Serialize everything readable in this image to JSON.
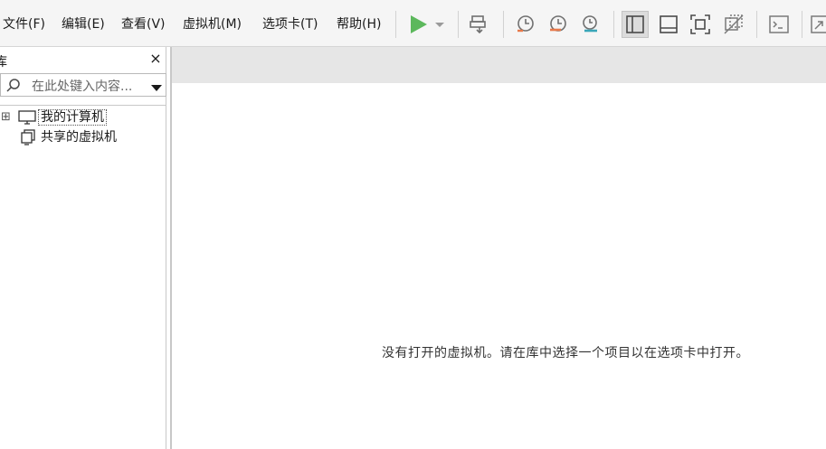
{
  "menu": {
    "items": [
      {
        "label": "文件(F)"
      },
      {
        "label": "编辑(E)"
      },
      {
        "label": "查看(V)"
      },
      {
        "label": "虚拟机(M)"
      },
      {
        "label": "选项卡(T)"
      },
      {
        "label": "帮助(H)"
      }
    ]
  },
  "toolbar": {
    "icons": [
      "play-icon",
      "play-dropdown-icon",
      "send-ctrl-alt-del-icon",
      "snapshot-take-icon",
      "snapshot-revert-icon",
      "snapshot-manager-icon",
      "show-library-icon",
      "thumbnail-bar-icon",
      "full-screen-icon",
      "unity-mode-icon",
      "console-view-icon",
      "stretch-guest-icon"
    ],
    "colors": {
      "play": "#5cb85c",
      "snapshot_accent": "#e8794a",
      "snapshot_teal": "#3aa6b9"
    }
  },
  "library": {
    "title": "库",
    "close_glyph": "×",
    "search": {
      "placeholder": "在此处键入内容..."
    },
    "tree": [
      {
        "label": "我的计算机",
        "expander": "⊞"
      },
      {
        "label": "共享的虚拟机"
      }
    ]
  },
  "main": {
    "empty_message": "没有打开的虚拟机。请在库中选择一个项目以在选项卡中打开。"
  }
}
